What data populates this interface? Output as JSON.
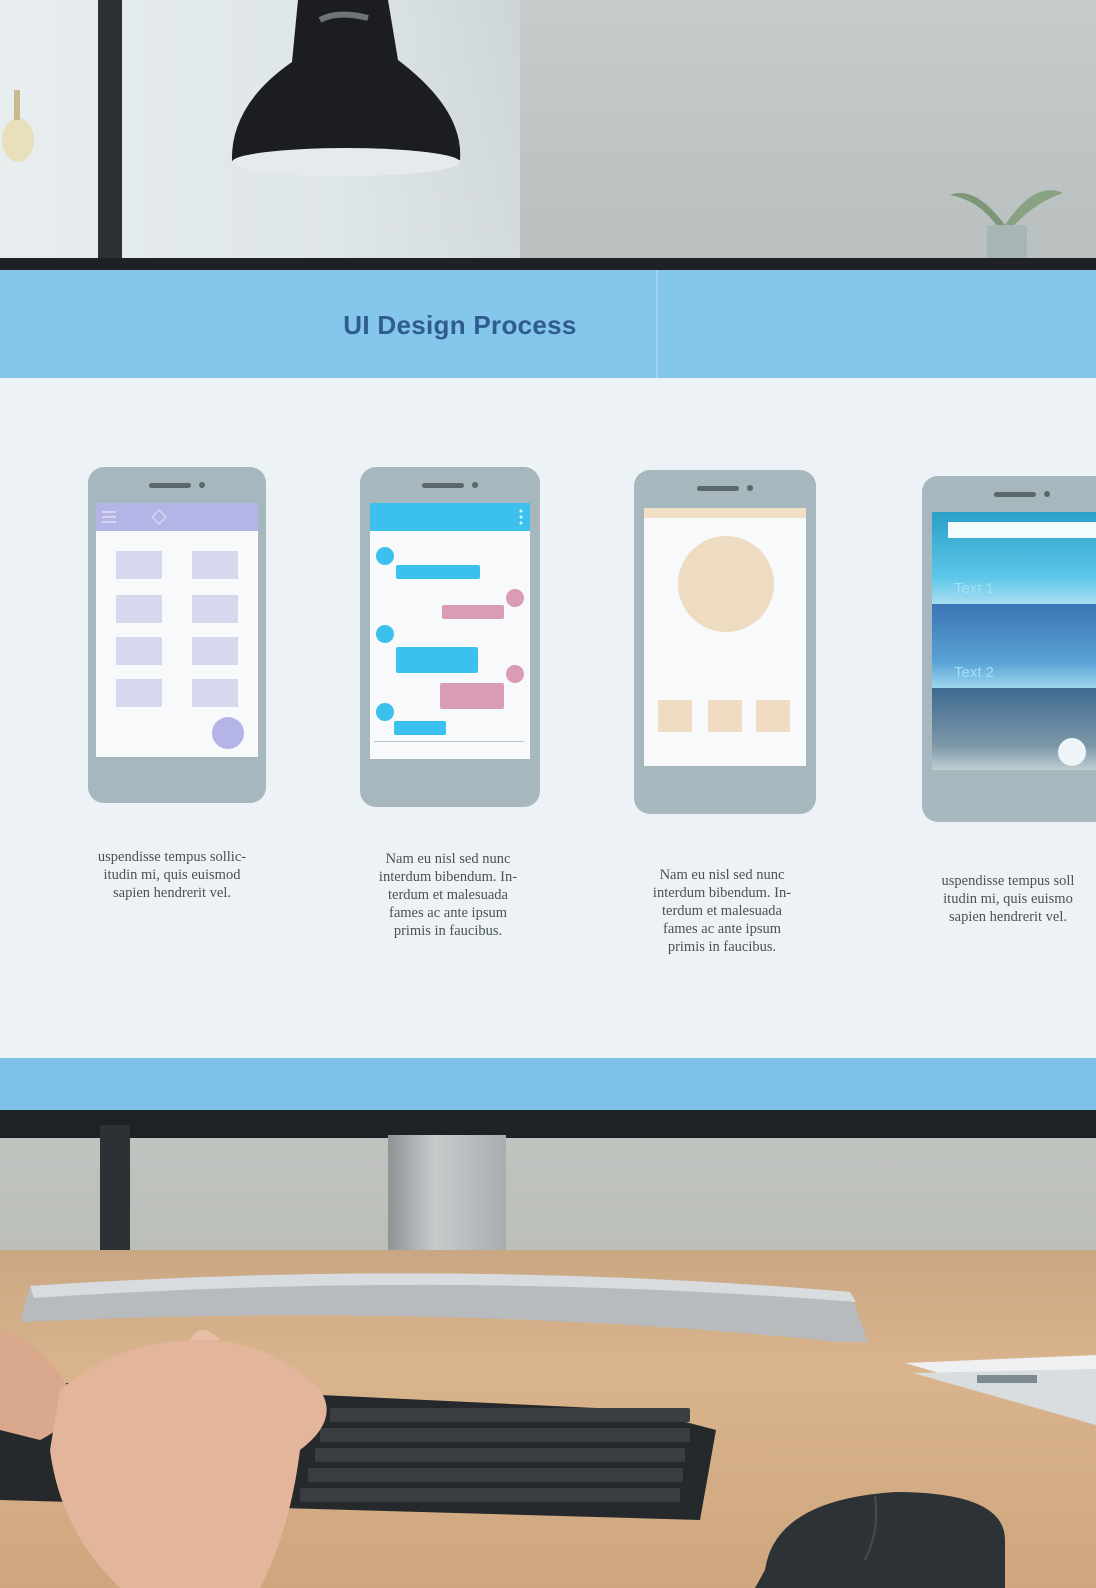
{
  "screen": {
    "title": "UI Design Process",
    "phones": [
      {
        "caption_lines": [
          "uspendisse tempus sollic-",
          "itudin mi, quis euismod",
          "sapien hendrerit vel."
        ]
      },
      {
        "caption_lines": [
          "Nam eu nisl sed nunc",
          "interdum bibendum. In-",
          "terdum et malesuada",
          "fames ac ante ipsum",
          "primis in faucibus."
        ]
      },
      {
        "caption_lines": [
          "Nam eu nisl sed nunc",
          "interdum bibendum. In-",
          "terdum et malesuada",
          "fames ac ante ipsum",
          "primis in faucibus."
        ]
      },
      {
        "labels": [
          "Text 1",
          "Text 2"
        ],
        "caption_lines": [
          "uspendisse tempus soll",
          "itudin mi, quis euismo",
          "sapien hendrerit vel."
        ]
      }
    ]
  },
  "colors": {
    "header": "#85c6eb",
    "title": "#2f5c8f",
    "screen_bg": "#ecf2f5",
    "accent_blue": "#3cc0ee",
    "accent_pink": "#d99cb4",
    "accent_lilac": "#b5b4e6"
  }
}
